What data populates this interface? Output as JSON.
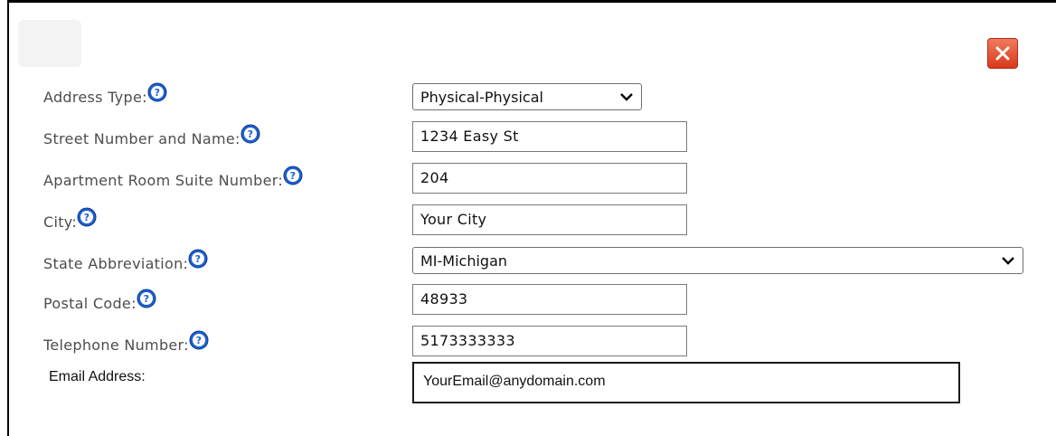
{
  "dialog": {
    "close_icon": "close-x-icon",
    "help_icon": "question-circle-icon",
    "accent": "#1f5fd1",
    "close_color": "#e0502f"
  },
  "form": {
    "address_type": {
      "label": "Address Type:",
      "value": "Physical-Physical"
    },
    "street": {
      "label": "Street Number and Name:",
      "value": "1234 Easy St"
    },
    "apartment": {
      "label": "Apartment Room Suite Number:",
      "value": "204"
    },
    "city": {
      "label": "City:",
      "value": "Your City"
    },
    "state": {
      "label": "State Abbreviation:",
      "value": "MI-Michigan"
    },
    "postal": {
      "label": "Postal Code:",
      "value": "48933"
    },
    "phone": {
      "label": "Telephone Number:",
      "value": "5173333333"
    },
    "email": {
      "label": "Email Address:",
      "value": "YourEmail@anydomain.com"
    }
  }
}
